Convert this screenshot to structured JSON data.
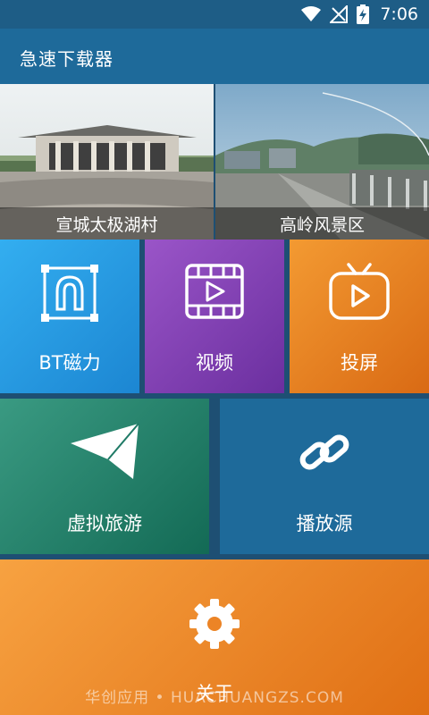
{
  "status_bar": {
    "time": "7:06"
  },
  "app": {
    "title": "急速下载器"
  },
  "banners": [
    {
      "caption": "宣城太极湖村"
    },
    {
      "caption": "高岭风景区"
    }
  ],
  "tiles": {
    "bt": {
      "label": "BT磁力",
      "icon": "magnet-icon",
      "color": "#2a9ee6"
    },
    "video": {
      "label": "视频",
      "icon": "film-icon",
      "color": "#7d3fb1"
    },
    "cast": {
      "label": "投屏",
      "icon": "tv-icon",
      "color": "#e5791c"
    },
    "vr": {
      "label": "虚拟旅游",
      "icon": "paper-plane-icon",
      "color": "#1f7a66"
    },
    "source": {
      "label": "播放源",
      "icon": "link-icon",
      "color": "#1e6a9a"
    },
    "about": {
      "label": "关于",
      "icon": "gear-icon",
      "color": "#ee8b26"
    }
  },
  "watermark": "华创应用 • HUACHUANGZS.COM"
}
